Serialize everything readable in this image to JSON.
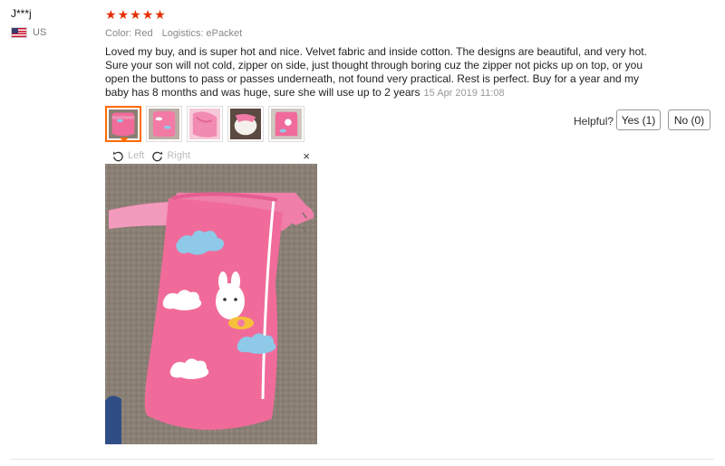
{
  "review": {
    "user": "J***j",
    "country": "US",
    "rating": 5,
    "color_label": "Color: Red",
    "logistics_label": "Logistics: ePacket",
    "text": "Loved my buy, and is super hot and nice. Velvet fabric and inside cotton. The designs are beautiful, and very hot. Sure your son will not cold, zipper on side, just thought through boring cuz the zipper not picks up on top, or you open the buttons to pass or passes underneath, not found very practical. Rest is perfect. Buy for a year and my baby has 8 months and was huge, sure she will use up to 2 years",
    "date": "15 Apr 2019 11:08"
  },
  "helpful": {
    "label": "Helpful?",
    "yes_label": "Yes (1)",
    "no_label": "No (0)"
  },
  "viewer": {
    "rotate_left_label": "Left",
    "rotate_right_label": "Right",
    "close_glyph": "×"
  },
  "icons": {
    "star": "star-icon",
    "flag": "us-flag-icon",
    "rotate_left": "rotate-left-icon",
    "rotate_right": "rotate-right-icon",
    "close": "close-icon"
  },
  "colors": {
    "star": "#e62e04",
    "active_thumb_border": "#ff6a00",
    "garment_pink": "#f06b9a",
    "carpet": "#8a7f74"
  }
}
